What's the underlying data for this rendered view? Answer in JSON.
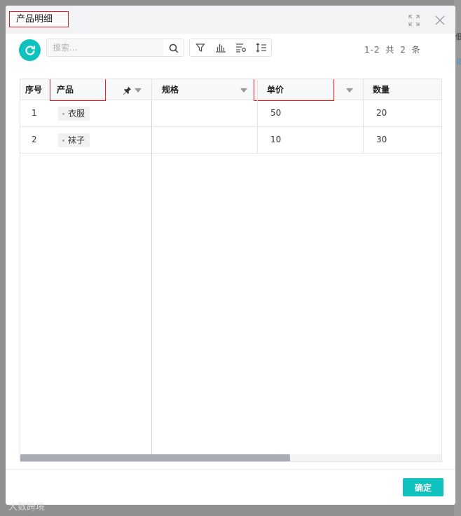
{
  "backdrop": {
    "glyph": "佃",
    "link_glyph": "贝"
  },
  "dialog": {
    "title": "产品明细",
    "expand_icon": "expand-icon",
    "close_icon": "close-icon"
  },
  "toolbar": {
    "refresh_icon": "refresh-icon",
    "search_placeholder": "搜索...",
    "search_value": "",
    "tools": [
      "filter-icon",
      "bar-chart-icon",
      "settings-table-icon",
      "sort-icon"
    ],
    "pager_text": "1-2 共 2 条"
  },
  "table": {
    "columns": [
      {
        "key": "index",
        "label": "序号"
      },
      {
        "key": "product",
        "label": "产品",
        "pinned": true
      },
      {
        "key": "spec",
        "label": "规格"
      },
      {
        "key": "price",
        "label": "单价"
      },
      {
        "key": "qty",
        "label": "数量"
      }
    ],
    "rows": [
      {
        "index": "1",
        "product": "衣服",
        "spec": "",
        "price": "50",
        "qty": "20"
      },
      {
        "index": "2",
        "product": "袜子",
        "spec": "",
        "price": "10",
        "qty": "30"
      }
    ]
  },
  "footer": {
    "confirm_label": "确定"
  },
  "watermark": "大数跨境",
  "colors": {
    "accent": "#0fc2bd",
    "highlight_box": "#e02020"
  }
}
